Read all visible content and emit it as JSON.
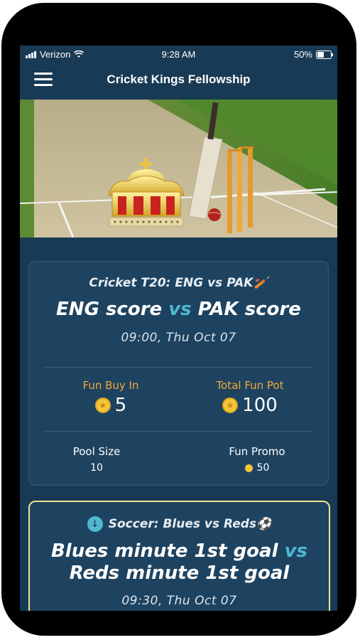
{
  "status_bar": {
    "carrier": "Verizon",
    "time": "9:28 AM",
    "battery": "50%",
    "battery_level": 0.5
  },
  "header": {
    "title": "Cricket Kings Fellowship",
    "menu_icon": "hamburger-menu-icon"
  },
  "colors": {
    "background": "#183a55",
    "card": "#1e4360",
    "accent_vs": "#4fb8cf",
    "label_gold": "#f2a83b",
    "highlight_border": "#f2e38c",
    "coin": "#f4c53a"
  },
  "games": [
    {
      "league": "Cricket T20: ENG vs PAK🏏",
      "team_a": "ENG score",
      "vs": "vs",
      "team_b": "PAK score",
      "time": "09:00, Thu Oct 07",
      "fun_buy_in_label": "Fun Buy In",
      "fun_buy_in": "5",
      "total_fun_pot_label": "Total Fun Pot",
      "total_fun_pot": "100",
      "pool_size_label": "Pool Size",
      "pool_size": "10",
      "fun_promo_label": "Fun Promo",
      "fun_promo": "50"
    },
    {
      "league": "Soccer: Blues vs Reds⚽",
      "team_a": "Blues minute 1st goal",
      "vs": "vs",
      "team_b": "Reds minute 1st goal",
      "time": "09:30, Thu Oct 07",
      "icon": "arrow-down-icon"
    }
  ]
}
